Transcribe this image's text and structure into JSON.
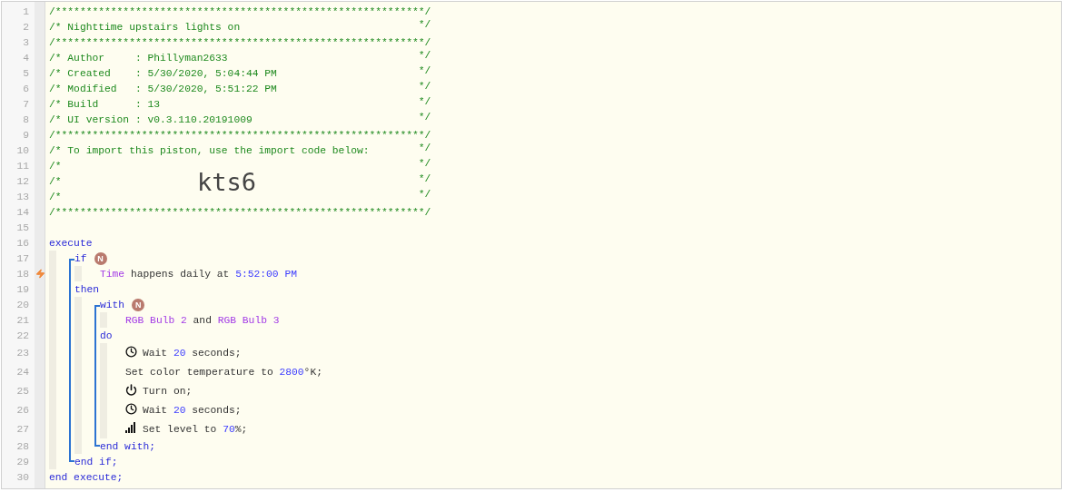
{
  "header": [
    {
      "number": "1",
      "text": "/************************************************************/"
    },
    {
      "number": "2",
      "text": "/* Nighttime upstairs lights on",
      "end": "*/"
    },
    {
      "number": "3",
      "text": "/************************************************************/"
    },
    {
      "number": "4",
      "text": "/* Author     : Phillyman2633",
      "end": "*/"
    },
    {
      "number": "5",
      "text": "/* Created    : 5/30/2020, 5:04:44 PM",
      "end": "*/"
    },
    {
      "number": "6",
      "text": "/* Modified   : 5/30/2020, 5:51:22 PM",
      "end": "*/"
    },
    {
      "number": "7",
      "text": "/* Build      : 13",
      "end": "*/"
    },
    {
      "number": "8",
      "text": "/* UI version : v0.3.110.20191009",
      "end": "*/"
    },
    {
      "number": "9",
      "text": "/************************************************************/"
    },
    {
      "number": "10",
      "text": "/* To import this piston, use the import code below:",
      "end": "*/"
    },
    {
      "number": "11",
      "text": "/*",
      "end": "*/"
    },
    {
      "number": "12",
      "text": "/*",
      "import_code": "kts6",
      "end": "*/"
    },
    {
      "number": "13",
      "text": "/*",
      "end": "*/"
    },
    {
      "number": "14",
      "text": "/************************************************************/"
    },
    {
      "number": "15"
    }
  ],
  "program": {
    "kind": "block",
    "parts": [
      {
        "kind": "line",
        "number": "16",
        "tokens": [
          {
            "kind": "keyword",
            "text": "execute"
          }
        ]
      },
      {
        "kind": "body",
        "children": [
          {
            "kind": "block",
            "bracket": true,
            "parts": [
              {
                "kind": "line",
                "number": "17",
                "tokens": [
                  {
                    "kind": "keyword",
                    "text": "if"
                  }
                ],
                "badge": "N"
              },
              {
                "kind": "body",
                "children": [
                  {
                    "kind": "line",
                    "number": "18",
                    "trigger": true,
                    "tokens": [
                      {
                        "kind": "device",
                        "text": "Time"
                      },
                      {
                        "kind": "text",
                        "text": " happens daily at "
                      },
                      {
                        "kind": "value",
                        "text": "5:52:00 PM"
                      }
                    ]
                  }
                ]
              },
              {
                "kind": "line",
                "number": "19",
                "tokens": [
                  {
                    "kind": "keyword",
                    "text": "then"
                  }
                ]
              },
              {
                "kind": "body",
                "children": [
                  {
                    "kind": "block",
                    "bracket": true,
                    "parts": [
                      {
                        "kind": "line",
                        "number": "20",
                        "tokens": [
                          {
                            "kind": "keyword",
                            "text": "with"
                          }
                        ],
                        "badge": "N"
                      },
                      {
                        "kind": "body",
                        "children": [
                          {
                            "kind": "line",
                            "number": "21",
                            "tokens": [
                              {
                                "kind": "device",
                                "text": "RGB Bulb 2"
                              },
                              {
                                "kind": "text",
                                "text": " and "
                              },
                              {
                                "kind": "device",
                                "text": "RGB Bulb 3"
                              }
                            ]
                          }
                        ]
                      },
                      {
                        "kind": "line",
                        "number": "22",
                        "tokens": [
                          {
                            "kind": "keyword",
                            "text": "do"
                          }
                        ]
                      },
                      {
                        "kind": "body",
                        "children": [
                          {
                            "kind": "wait",
                            "number": "23",
                            "tokens": [
                              {
                                "kind": "text",
                                "text": "Wait "
                              },
                              {
                                "kind": "value",
                                "text": "20"
                              },
                              {
                                "kind": "text",
                                "text": " seconds;"
                              }
                            ]
                          },
                          {
                            "kind": "line",
                            "number": "24",
                            "tokens": [
                              {
                                "kind": "text",
                                "text": "Set color temperature to "
                              },
                              {
                                "kind": "value",
                                "text": "2800"
                              },
                              {
                                "kind": "text",
                                "text": "°K;"
                              }
                            ]
                          },
                          {
                            "kind": "switch",
                            "number": "25",
                            "tokens": [
                              {
                                "kind": "text",
                                "text": "Turn on;"
                              }
                            ]
                          },
                          {
                            "kind": "wait",
                            "number": "26",
                            "tokens": [
                              {
                                "kind": "text",
                                "text": "Wait "
                              },
                              {
                                "kind": "value",
                                "text": "20"
                              },
                              {
                                "kind": "text",
                                "text": " seconds;"
                              }
                            ]
                          },
                          {
                            "kind": "level",
                            "number": "27",
                            "tokens": [
                              {
                                "kind": "text",
                                "text": "Set level to "
                              },
                              {
                                "kind": "value",
                                "text": "70"
                              },
                              {
                                "kind": "text",
                                "text": "%;"
                              }
                            ]
                          }
                        ]
                      },
                      {
                        "kind": "line",
                        "number": "28",
                        "tokens": [
                          {
                            "kind": "keyword",
                            "text": "end with;"
                          }
                        ]
                      }
                    ]
                  }
                ]
              },
              {
                "kind": "line",
                "number": "29",
                "tokens": [
                  {
                    "kind": "keyword",
                    "text": "end if;"
                  }
                ]
              }
            ]
          }
        ]
      },
      {
        "kind": "line",
        "number": "30",
        "tokens": [
          {
            "kind": "keyword",
            "text": "end execute;"
          }
        ]
      }
    ]
  }
}
